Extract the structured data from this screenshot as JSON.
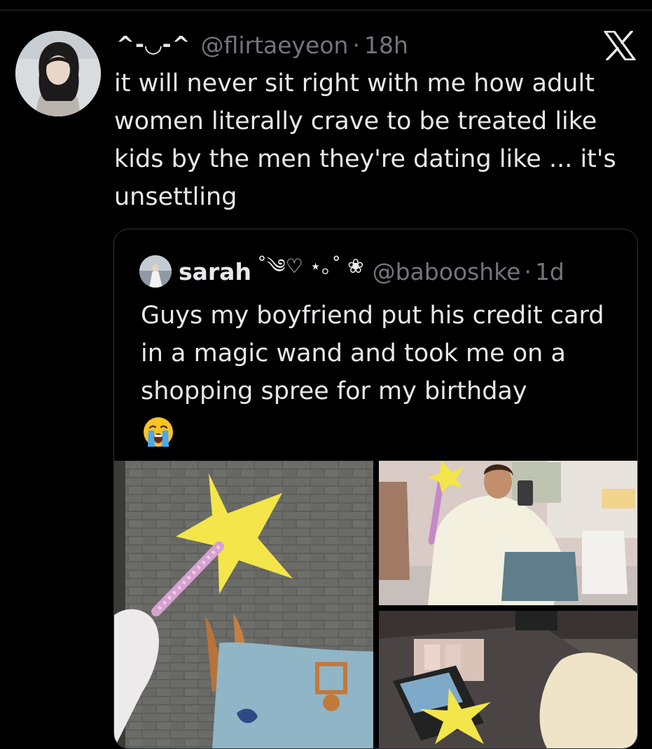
{
  "tweet": {
    "display_name": "^-◡-^",
    "handle": "@flirtaeyeon",
    "separator": "·",
    "time": "18h",
    "text": "it will never sit right with me how adult women literally crave to be treated like kids by the men they're dating like ... it's unsettling"
  },
  "quoted_tweet": {
    "name": "sarah",
    "decoration": "˚༄♡ ⋆｡˚ ❀",
    "handle": "@babooshke",
    "separator": "·",
    "time": "1d",
    "text": "Guys my boyfriend put his credit card in a magic wand and took me on a shopping spree for my birthday",
    "emoji": "loudly-crying-face"
  },
  "media_count": 3,
  "icons": [
    "x-logo-icon",
    "crying-face-emoji"
  ],
  "colors": {
    "background": "#000000",
    "text": "#e7e9ea",
    "secondary": "#71767b",
    "border": "#2f3336"
  }
}
